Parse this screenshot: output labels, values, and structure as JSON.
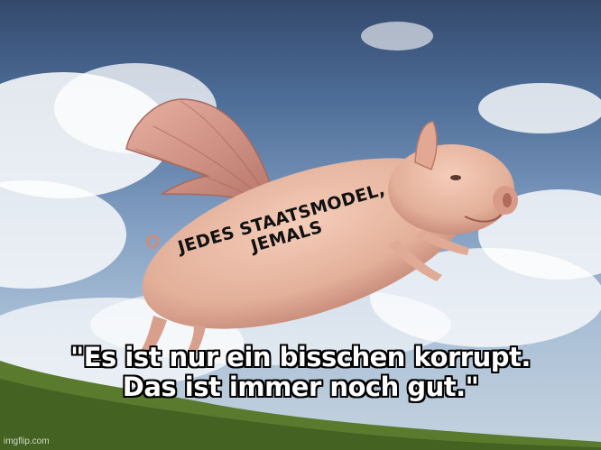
{
  "meme": {
    "top_caption_lines": [
      "JEDES STAATSMODEL,",
      "JEMALS"
    ],
    "bottom_caption_lines": [
      "\"Es ist nur ein bisschen korrupt.",
      "Das ist immer noch gut.\""
    ],
    "watermark": "imgflip.com"
  },
  "scene": {
    "subject": "flying-pig-with-wings",
    "sky_colors": [
      "#34496c",
      "#7f9cc0",
      "#c6d3df"
    ],
    "pig_color": "#e6b8a3",
    "wing_color": "#cf8f80",
    "hill_color": "#5a7a2e"
  }
}
